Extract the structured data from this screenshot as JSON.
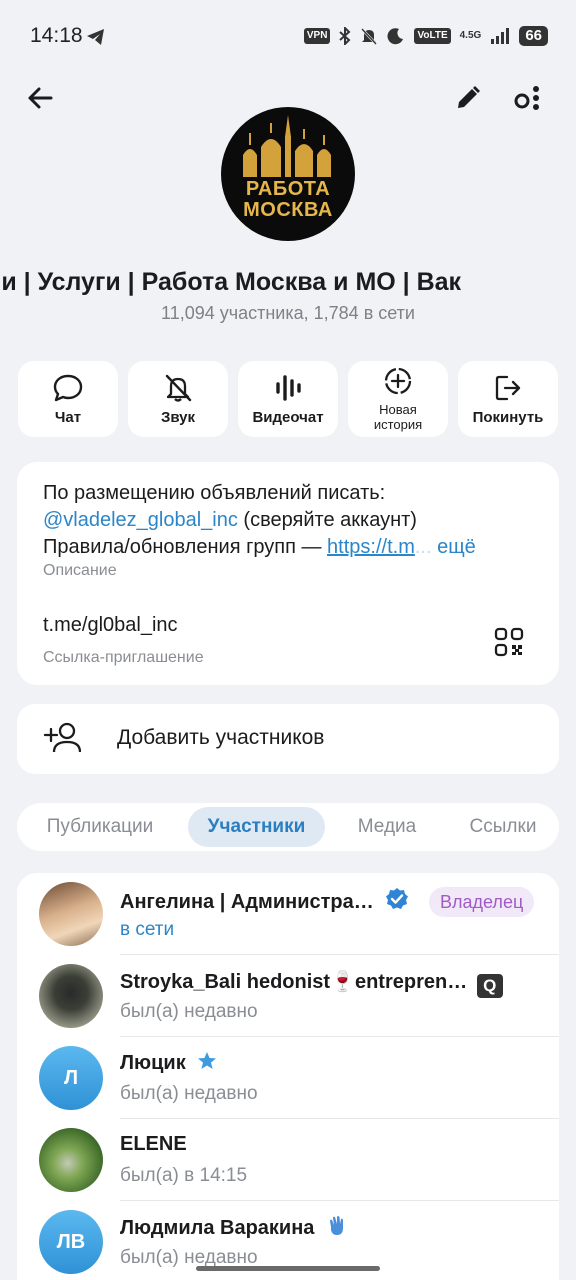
{
  "status_bar": {
    "time": "14:18",
    "vpn": "VPN",
    "volte": "VoLTE",
    "network": "4.5G",
    "battery": "66"
  },
  "profile": {
    "avatar_line1": "РАБОТА",
    "avatar_line2": "МОСКВА",
    "title": "ии | Услуги | Работа    Москва и МО | Вак",
    "subtitle": "11,094 участника, 1,784 в сети"
  },
  "actions": [
    {
      "label": "Чат",
      "icon": "chat-bubble-icon"
    },
    {
      "label": "Звук",
      "icon": "bell-off-icon"
    },
    {
      "label": "Видеочат",
      "icon": "voice-wave-icon"
    },
    {
      "label_line1": "Новая",
      "label_line2": "история",
      "icon": "add-story-icon"
    },
    {
      "label": "Покинуть",
      "icon": "leave-icon"
    }
  ],
  "info": {
    "desc_line1": "По размещению объявлений писать:",
    "desc_handle": "@vladelez_global_inc",
    "desc_line2_rest": " (сверяйте аккаунт)",
    "desc_line3": "Правила/обновления групп — ",
    "desc_link": "https://t.m",
    "desc_more": "ещё",
    "desc_caption": "Описание",
    "link_value": "t.me/gl0bal_inc",
    "link_caption": "Ссылка-приглашение"
  },
  "add_members": {
    "label": "Добавить участников"
  },
  "tabs": [
    "Публикации",
    "Участники",
    "Медиа",
    "Ссылки"
  ],
  "active_tab": "Участники",
  "members": [
    {
      "name": "Ангелина | Администра…",
      "status": "в сети",
      "badge": "Владелец",
      "initials": "",
      "color": "#c9a88a"
    },
    {
      "name": "Stroyka_Bali hedonist🍷entrepren…",
      "status": "был(а) недавно",
      "initials": "",
      "color": "#6b6f66"
    },
    {
      "name": "Люцик",
      "status": "был(а) недавно",
      "initials": "Л",
      "color": "#3ea2e0"
    },
    {
      "name": "ELENE",
      "status": "был(а) в 14:15",
      "initials": "",
      "color": "#5b8a3e"
    },
    {
      "name": "Людмила Варакина",
      "status": "был(а) недавно",
      "initials": "ЛВ",
      "color": "#3ea2e0"
    }
  ],
  "colors": {
    "accent": "#2a86c8",
    "owner_badge": "#a05bc7",
    "background": "#f1f2f6"
  }
}
